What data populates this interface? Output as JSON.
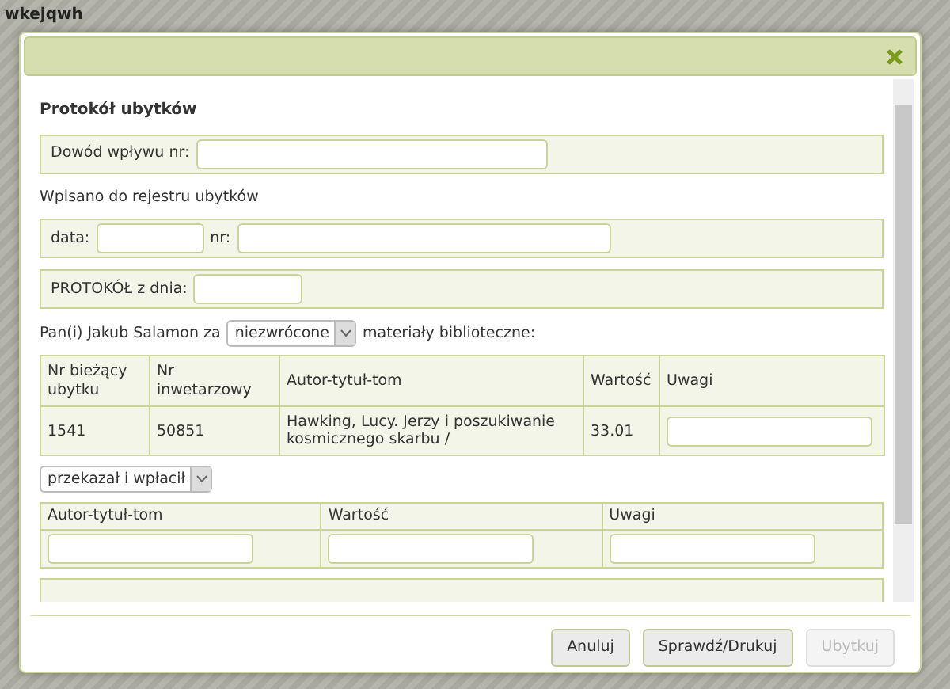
{
  "background": {
    "label": "wkejqwh"
  },
  "dialog": {
    "heading": "Protokół ubytków",
    "receipt_field": {
      "label": "Dowód wpływu nr:"
    },
    "register_caption": "Wpisano do rejestru ubytków",
    "register_fields": [
      {
        "label": "data:"
      },
      {
        "label": "nr:"
      }
    ],
    "protocol_field": {
      "label": "PROTOKÓŁ z dnia:"
    },
    "statement": {
      "before": "Pan(i) Jakub Salamon za",
      "select": "niezwrócone",
      "after": "materiały biblioteczne:"
    },
    "items_table": {
      "columns": [
        "Nr bieżący ubytku",
        "Nr inwetarzowy",
        "Autor-tytuł-tom",
        "Wartość",
        "Uwagi"
      ],
      "rows": [
        {
          "cells": [
            "1541",
            "50851",
            "Hawking, Lucy. Jerzy i poszukiwanie kosmicznego skarbu /",
            "33.01"
          ]
        }
      ]
    },
    "replacement_select": "przekazał i wpłacił",
    "replacement_table": {
      "columns": [
        "Autor-tytuł-tom",
        "Wartość",
        "Uwagi"
      ]
    },
    "buttons": [
      {
        "label": "Anuluj",
        "disabled": false
      },
      {
        "label": "Sprawdź/Drukuj",
        "disabled": false
      },
      {
        "label": "Ubytkuj",
        "disabled": true
      }
    ]
  }
}
